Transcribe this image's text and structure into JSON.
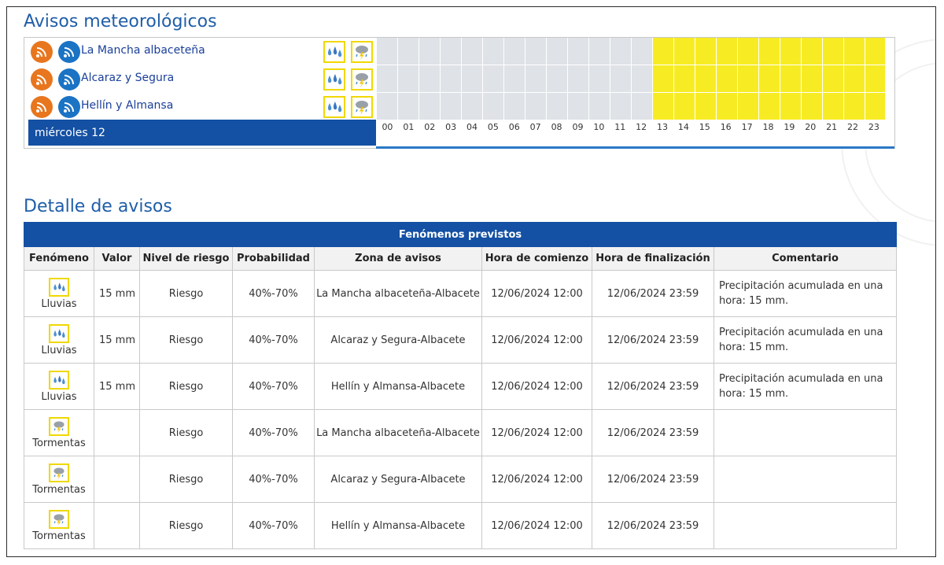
{
  "section_titles": {
    "avisos": "Avisos meteorológicos",
    "detalle": "Detalle de avisos"
  },
  "timeline": {
    "day_label": "miércoles 12",
    "hours": [
      "00",
      "01",
      "02",
      "03",
      "04",
      "05",
      "06",
      "07",
      "08",
      "09",
      "10",
      "11",
      "12",
      "13",
      "14",
      "15",
      "16",
      "17",
      "18",
      "19",
      "20",
      "21",
      "22",
      "23"
    ],
    "warning_hours_start": 13,
    "zones": [
      {
        "name": "La Mancha albaceteña"
      },
      {
        "name": "Alcaraz y Segura"
      },
      {
        "name": "Hellín y Almansa"
      }
    ]
  },
  "table": {
    "caption": "Fenómenos previstos",
    "headers": [
      "Fenómeno",
      "Valor",
      "Nivel de riesgo",
      "Probabilidad",
      "Zona de avisos",
      "Hora de comienzo",
      "Hora de finalización",
      "Comentario"
    ],
    "rows": [
      {
        "fenomeno": "Lluvias",
        "icon": "rain-icon",
        "valor": "15 mm",
        "nivel": "Riesgo",
        "prob": "40%-70%",
        "zona": "La Mancha albaceteña-Albacete",
        "inicio": "12/06/2024 12:00",
        "fin": "12/06/2024 23:59",
        "comentario": "Precipitación acumulada en una hora: 15 mm."
      },
      {
        "fenomeno": "Lluvias",
        "icon": "rain-icon",
        "valor": "15 mm",
        "nivel": "Riesgo",
        "prob": "40%-70%",
        "zona": "Alcaraz y Segura-Albacete",
        "inicio": "12/06/2024 12:00",
        "fin": "12/06/2024 23:59",
        "comentario": "Precipitación acumulada en una hora: 15 mm."
      },
      {
        "fenomeno": "Lluvias",
        "icon": "rain-icon",
        "valor": "15 mm",
        "nivel": "Riesgo",
        "prob": "40%-70%",
        "zona": "Hellín y Almansa-Albacete",
        "inicio": "12/06/2024 12:00",
        "fin": "12/06/2024 23:59",
        "comentario": "Precipitación acumulada en una hora: 15 mm."
      },
      {
        "fenomeno": "Tormentas",
        "icon": "storm-icon",
        "valor": "",
        "nivel": "Riesgo",
        "prob": "40%-70%",
        "zona": "La Mancha albaceteña-Albacete",
        "inicio": "12/06/2024 12:00",
        "fin": "12/06/2024 23:59",
        "comentario": ""
      },
      {
        "fenomeno": "Tormentas",
        "icon": "storm-icon",
        "valor": "",
        "nivel": "Riesgo",
        "prob": "40%-70%",
        "zona": "Alcaraz y Segura-Albacete",
        "inicio": "12/06/2024 12:00",
        "fin": "12/06/2024 23:59",
        "comentario": ""
      },
      {
        "fenomeno": "Tormentas",
        "icon": "storm-icon",
        "valor": "",
        "nivel": "Riesgo",
        "prob": "40%-70%",
        "zona": "Hellín y Almansa-Albacete",
        "inicio": "12/06/2024 12:00",
        "fin": "12/06/2024 23:59",
        "comentario": ""
      }
    ]
  },
  "colors": {
    "accent_blue": "#1450a3",
    "warning_yellow": "#f7ec24",
    "no_warning_grey": "#dfe2e7",
    "rss_orange": "#e8761e",
    "rss_blue": "#1b73c4"
  }
}
